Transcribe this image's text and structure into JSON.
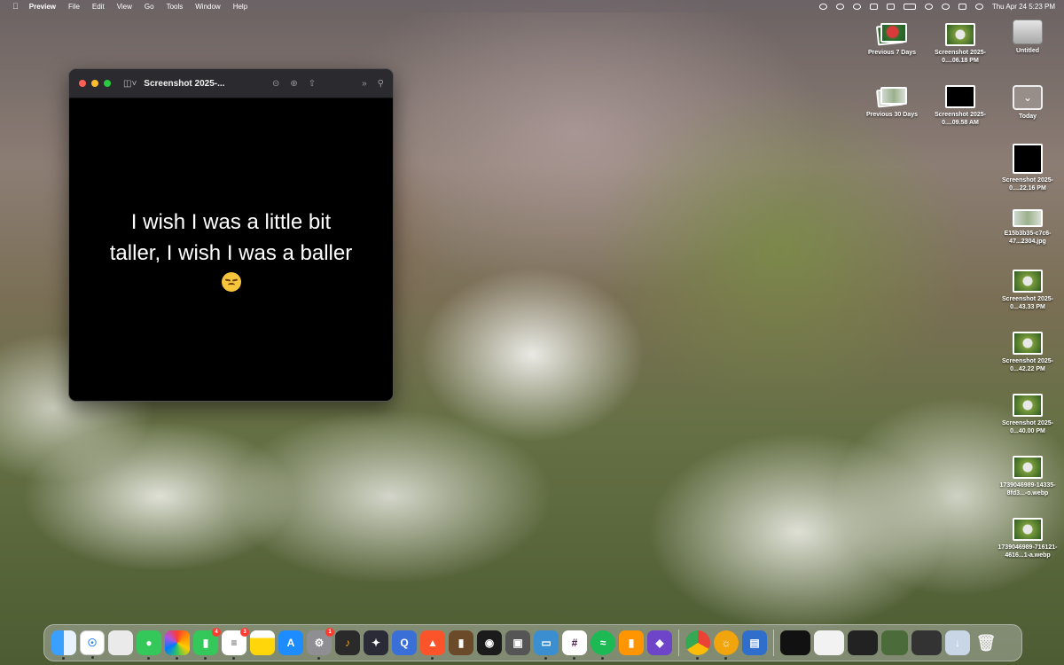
{
  "menubar": {
    "app": "Preview",
    "items": [
      "File",
      "Edit",
      "View",
      "Go",
      "Tools",
      "Window",
      "Help"
    ],
    "clock": "Thu Apr 24  5:23 PM"
  },
  "window": {
    "title": "Screenshot 2025-...",
    "lines": [
      "I wish I was a little bit",
      "taller, I wish I was a baller"
    ],
    "emoji": "pensive-face"
  },
  "desktop": [
    {
      "label": "Previous 7 Days"
    },
    {
      "label": "Screenshot 2025-0....06.18 PM"
    },
    {
      "label": "Untitled"
    },
    {
      "label": "Previous 30 Days"
    },
    {
      "label": "Screenshot 2025-0....09.58 AM"
    },
    {
      "label": "Today"
    },
    {
      "label": "Screenshot 2025-0....22.16 PM"
    },
    {
      "label": "E15b3b35-c7c6-47...2304.jpg"
    },
    {
      "label": "Screenshot 2025-0...43.33 PM"
    },
    {
      "label": "Screenshot 2025-0...42.22 PM"
    },
    {
      "label": "Screenshot 2025-0...40.00 PM"
    },
    {
      "label": "1739046989-14335-8fd3...-o.webp"
    },
    {
      "label": "1739046989-716121-4616...1-a.webp"
    }
  ],
  "dock": {
    "badges": {
      "facetime": "4",
      "reminders": "3",
      "settings": "1"
    }
  }
}
